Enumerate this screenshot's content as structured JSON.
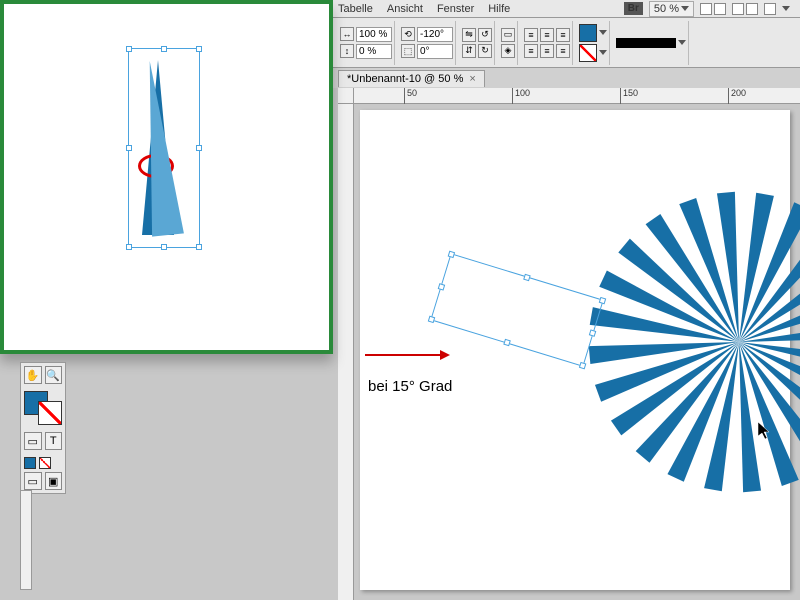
{
  "menu": {
    "tabelle": "Tabelle",
    "ansicht": "Ansicht",
    "fenster": "Fenster",
    "hilfe": "Hilfe",
    "br": "Br",
    "zoom": "50 %"
  },
  "controls": {
    "scaleX": "100 %",
    "scaleY": "0 %",
    "rotate1": "-120°",
    "rotate2": "0°"
  },
  "doc": {
    "title": "*Unbenannt-10 @ 50 %",
    "close": "×"
  },
  "ruler": {
    "t50": "50",
    "t100": "100",
    "t150": "150",
    "t200": "200"
  },
  "annotation": {
    "text": "bei 15° Grad"
  },
  "colors": {
    "accent": "#176fa6"
  }
}
